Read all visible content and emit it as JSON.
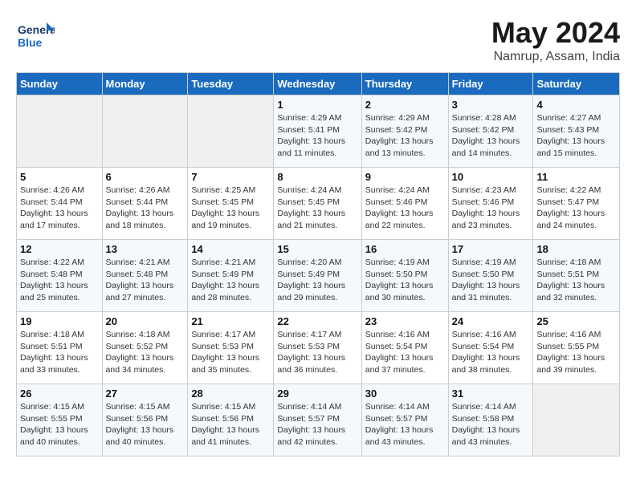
{
  "header": {
    "logo_text_general": "General",
    "logo_text_blue": "Blue",
    "month_title": "May 2024",
    "location": "Namrup, Assam, India"
  },
  "weekdays": [
    "Sunday",
    "Monday",
    "Tuesday",
    "Wednesday",
    "Thursday",
    "Friday",
    "Saturday"
  ],
  "weeks": [
    [
      {
        "day": "",
        "sunrise": "",
        "sunset": "",
        "daylight": ""
      },
      {
        "day": "",
        "sunrise": "",
        "sunset": "",
        "daylight": ""
      },
      {
        "day": "",
        "sunrise": "",
        "sunset": "",
        "daylight": ""
      },
      {
        "day": "1",
        "sunrise": "Sunrise: 4:29 AM",
        "sunset": "Sunset: 5:41 PM",
        "daylight": "Daylight: 13 hours and 11 minutes."
      },
      {
        "day": "2",
        "sunrise": "Sunrise: 4:29 AM",
        "sunset": "Sunset: 5:42 PM",
        "daylight": "Daylight: 13 hours and 13 minutes."
      },
      {
        "day": "3",
        "sunrise": "Sunrise: 4:28 AM",
        "sunset": "Sunset: 5:42 PM",
        "daylight": "Daylight: 13 hours and 14 minutes."
      },
      {
        "day": "4",
        "sunrise": "Sunrise: 4:27 AM",
        "sunset": "Sunset: 5:43 PM",
        "daylight": "Daylight: 13 hours and 15 minutes."
      }
    ],
    [
      {
        "day": "5",
        "sunrise": "Sunrise: 4:26 AM",
        "sunset": "Sunset: 5:44 PM",
        "daylight": "Daylight: 13 hours and 17 minutes."
      },
      {
        "day": "6",
        "sunrise": "Sunrise: 4:26 AM",
        "sunset": "Sunset: 5:44 PM",
        "daylight": "Daylight: 13 hours and 18 minutes."
      },
      {
        "day": "7",
        "sunrise": "Sunrise: 4:25 AM",
        "sunset": "Sunset: 5:45 PM",
        "daylight": "Daylight: 13 hours and 19 minutes."
      },
      {
        "day": "8",
        "sunrise": "Sunrise: 4:24 AM",
        "sunset": "Sunset: 5:45 PM",
        "daylight": "Daylight: 13 hours and 21 minutes."
      },
      {
        "day": "9",
        "sunrise": "Sunrise: 4:24 AM",
        "sunset": "Sunset: 5:46 PM",
        "daylight": "Daylight: 13 hours and 22 minutes."
      },
      {
        "day": "10",
        "sunrise": "Sunrise: 4:23 AM",
        "sunset": "Sunset: 5:46 PM",
        "daylight": "Daylight: 13 hours and 23 minutes."
      },
      {
        "day": "11",
        "sunrise": "Sunrise: 4:22 AM",
        "sunset": "Sunset: 5:47 PM",
        "daylight": "Daylight: 13 hours and 24 minutes."
      }
    ],
    [
      {
        "day": "12",
        "sunrise": "Sunrise: 4:22 AM",
        "sunset": "Sunset: 5:48 PM",
        "daylight": "Daylight: 13 hours and 25 minutes."
      },
      {
        "day": "13",
        "sunrise": "Sunrise: 4:21 AM",
        "sunset": "Sunset: 5:48 PM",
        "daylight": "Daylight: 13 hours and 27 minutes."
      },
      {
        "day": "14",
        "sunrise": "Sunrise: 4:21 AM",
        "sunset": "Sunset: 5:49 PM",
        "daylight": "Daylight: 13 hours and 28 minutes."
      },
      {
        "day": "15",
        "sunrise": "Sunrise: 4:20 AM",
        "sunset": "Sunset: 5:49 PM",
        "daylight": "Daylight: 13 hours and 29 minutes."
      },
      {
        "day": "16",
        "sunrise": "Sunrise: 4:19 AM",
        "sunset": "Sunset: 5:50 PM",
        "daylight": "Daylight: 13 hours and 30 minutes."
      },
      {
        "day": "17",
        "sunrise": "Sunrise: 4:19 AM",
        "sunset": "Sunset: 5:50 PM",
        "daylight": "Daylight: 13 hours and 31 minutes."
      },
      {
        "day": "18",
        "sunrise": "Sunrise: 4:18 AM",
        "sunset": "Sunset: 5:51 PM",
        "daylight": "Daylight: 13 hours and 32 minutes."
      }
    ],
    [
      {
        "day": "19",
        "sunrise": "Sunrise: 4:18 AM",
        "sunset": "Sunset: 5:51 PM",
        "daylight": "Daylight: 13 hours and 33 minutes."
      },
      {
        "day": "20",
        "sunrise": "Sunrise: 4:18 AM",
        "sunset": "Sunset: 5:52 PM",
        "daylight": "Daylight: 13 hours and 34 minutes."
      },
      {
        "day": "21",
        "sunrise": "Sunrise: 4:17 AM",
        "sunset": "Sunset: 5:53 PM",
        "daylight": "Daylight: 13 hours and 35 minutes."
      },
      {
        "day": "22",
        "sunrise": "Sunrise: 4:17 AM",
        "sunset": "Sunset: 5:53 PM",
        "daylight": "Daylight: 13 hours and 36 minutes."
      },
      {
        "day": "23",
        "sunrise": "Sunrise: 4:16 AM",
        "sunset": "Sunset: 5:54 PM",
        "daylight": "Daylight: 13 hours and 37 minutes."
      },
      {
        "day": "24",
        "sunrise": "Sunrise: 4:16 AM",
        "sunset": "Sunset: 5:54 PM",
        "daylight": "Daylight: 13 hours and 38 minutes."
      },
      {
        "day": "25",
        "sunrise": "Sunrise: 4:16 AM",
        "sunset": "Sunset: 5:55 PM",
        "daylight": "Daylight: 13 hours and 39 minutes."
      }
    ],
    [
      {
        "day": "26",
        "sunrise": "Sunrise: 4:15 AM",
        "sunset": "Sunset: 5:55 PM",
        "daylight": "Daylight: 13 hours and 40 minutes."
      },
      {
        "day": "27",
        "sunrise": "Sunrise: 4:15 AM",
        "sunset": "Sunset: 5:56 PM",
        "daylight": "Daylight: 13 hours and 40 minutes."
      },
      {
        "day": "28",
        "sunrise": "Sunrise: 4:15 AM",
        "sunset": "Sunset: 5:56 PM",
        "daylight": "Daylight: 13 hours and 41 minutes."
      },
      {
        "day": "29",
        "sunrise": "Sunrise: 4:14 AM",
        "sunset": "Sunset: 5:57 PM",
        "daylight": "Daylight: 13 hours and 42 minutes."
      },
      {
        "day": "30",
        "sunrise": "Sunrise: 4:14 AM",
        "sunset": "Sunset: 5:57 PM",
        "daylight": "Daylight: 13 hours and 43 minutes."
      },
      {
        "day": "31",
        "sunrise": "Sunrise: 4:14 AM",
        "sunset": "Sunset: 5:58 PM",
        "daylight": "Daylight: 13 hours and 43 minutes."
      },
      {
        "day": "",
        "sunrise": "",
        "sunset": "",
        "daylight": ""
      }
    ]
  ]
}
